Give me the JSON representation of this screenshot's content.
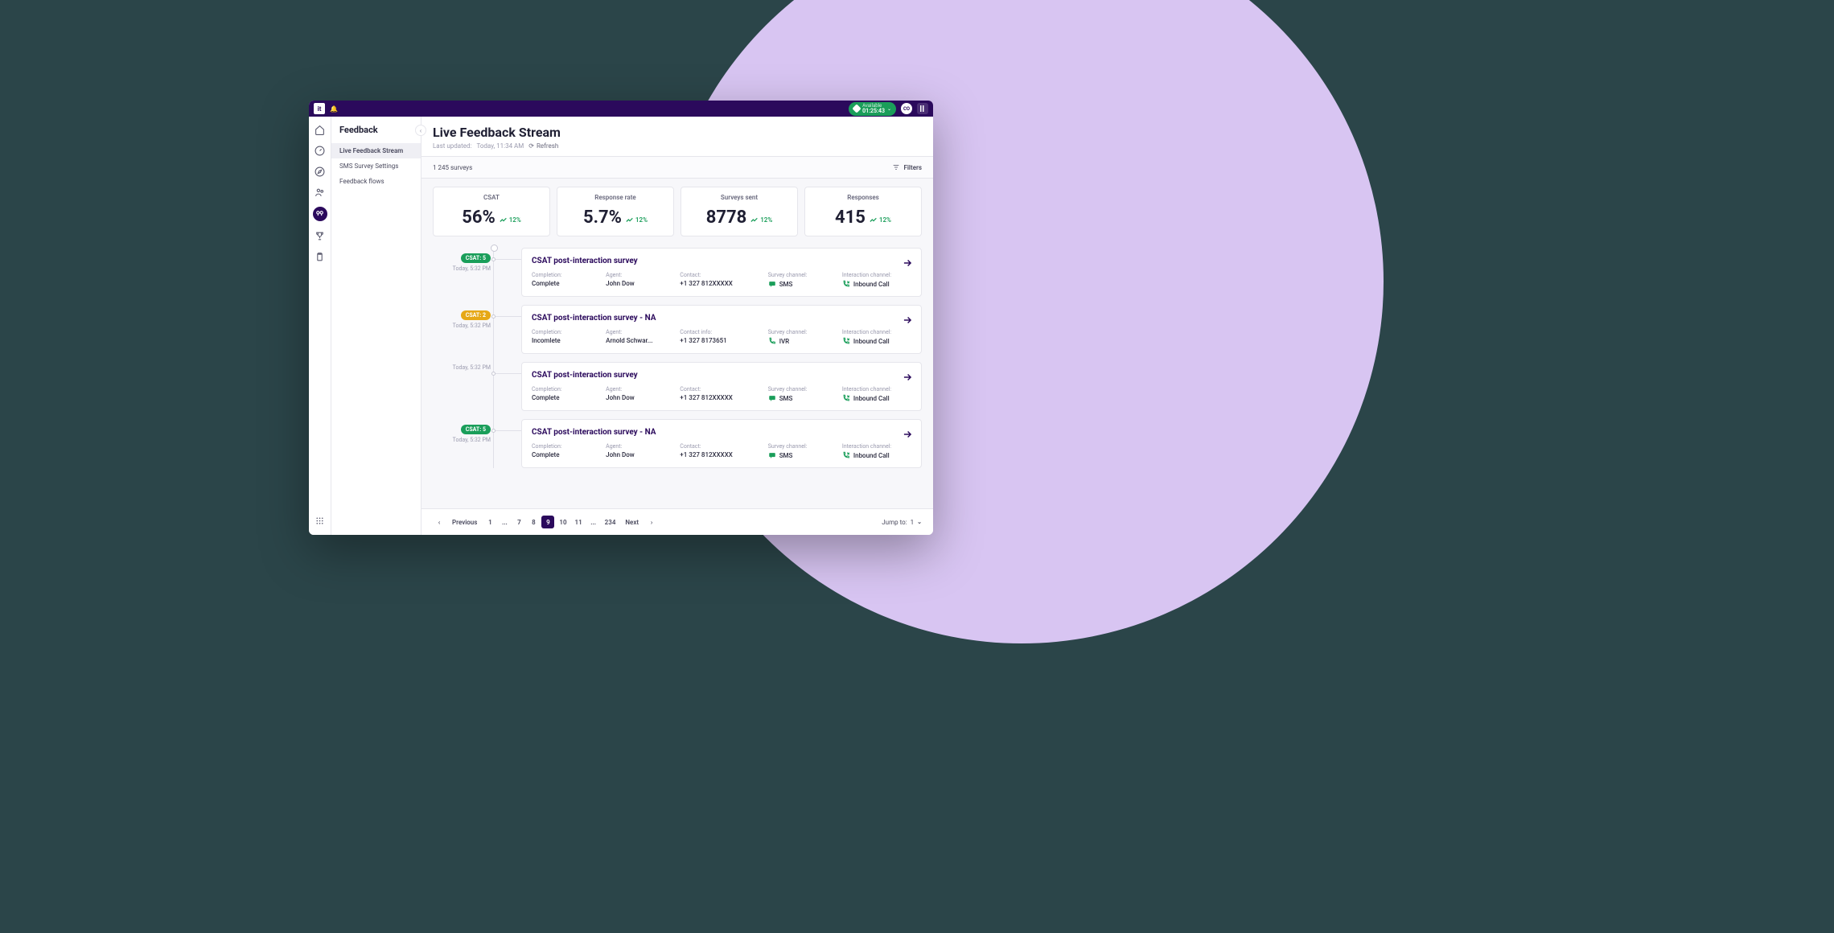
{
  "titlebar": {
    "logo": "it",
    "status_label": "Available",
    "status_time": "01:25:43",
    "avatar_initials": "CO"
  },
  "sidebar": {
    "title": "Feedback",
    "items": [
      {
        "label": "Live Feedback Stream",
        "active": true
      },
      {
        "label": "SMS Survey Settings",
        "active": false
      },
      {
        "label": "Feedback flows",
        "active": false
      }
    ]
  },
  "header": {
    "title": "Live Feedback Stream",
    "last_updated_prefix": "Last updated:",
    "last_updated": "Today, 11:34 AM",
    "refresh_label": "Refresh"
  },
  "toolbar": {
    "survey_count": "1 245 surveys",
    "filters_label": "Filters"
  },
  "kpis": [
    {
      "label": "CSAT",
      "value": "56%",
      "delta": "12%"
    },
    {
      "label": "Response rate",
      "value": "5.7%",
      "delta": "12%"
    },
    {
      "label": "Surveys sent",
      "value": "8778",
      "delta": "12%"
    },
    {
      "label": "Responses",
      "value": "415",
      "delta": "12%"
    }
  ],
  "field_labels": {
    "completion": "Completion:",
    "agent": "Agent:",
    "contact": "Contact:",
    "contact_info": "Contact info:",
    "survey_channel": "Survey channel:",
    "interaction_channel": "Interaction channel:"
  },
  "feed": [
    {
      "badge": "CSAT: 5",
      "badge_color": "green",
      "time": "Today, 5:32 PM",
      "title": "CSAT post-interaction survey",
      "completion": "Complete",
      "agent": "John Dow",
      "contact": "+1 327 812XXXXX",
      "survey_channel": "SMS",
      "survey_icon": "sms",
      "interaction_channel": "Inbound Call",
      "interaction_icon": "call",
      "contact_label_key": "contact"
    },
    {
      "badge": "CSAT: 2",
      "badge_color": "amber",
      "time": "Today, 5:32 PM",
      "title": "CSAT post-interaction survey - NA",
      "completion": "Incomlete",
      "agent": "Arnold Schwar...",
      "contact": "+1 327 8173651",
      "survey_channel": "IVR",
      "survey_icon": "ivr",
      "interaction_channel": "Inbound Call",
      "interaction_icon": "call",
      "contact_label_key": "contact_info"
    },
    {
      "badge": "",
      "badge_color": "",
      "time": "Today, 5:32 PM",
      "title": "CSAT post-interaction survey",
      "completion": "Complete",
      "agent": "John Dow",
      "contact": "+1 327 812XXXXX",
      "survey_channel": "SMS",
      "survey_icon": "sms",
      "interaction_channel": "Inbound Call",
      "interaction_icon": "call",
      "contact_label_key": "contact"
    },
    {
      "badge": "CSAT: 5",
      "badge_color": "green",
      "time": "Today, 5:32 PM",
      "title": "CSAT post-interaction survey - NA",
      "completion": "Complete",
      "agent": "John Dow",
      "contact": "+1 327 812XXXXX",
      "survey_channel": "SMS",
      "survey_icon": "sms",
      "interaction_channel": "Inbound Call",
      "interaction_icon": "call",
      "contact_label_key": "contact"
    }
  ],
  "pagination": {
    "prev": "Previous",
    "next": "Next",
    "pages": [
      "1",
      "...",
      "7",
      "8",
      "9",
      "10",
      "11",
      "...",
      "234"
    ],
    "active": "9",
    "jump_label": "Jump to:",
    "jump_value": "1"
  }
}
